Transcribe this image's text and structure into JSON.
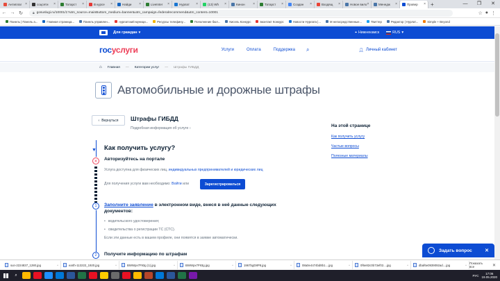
{
  "browser": {
    "tabs": [
      {
        "label": "Антиплаг",
        "color": "#e74c3c"
      },
      {
        "label": "соцсети",
        "color": "#333333"
      },
      {
        "label": "Татарст",
        "color": "#2e7d32"
      },
      {
        "label": "В курсе",
        "color": "#e53935"
      },
      {
        "label": "Найди",
        "color": "#1565c0"
      },
      {
        "label": "LiveInter",
        "color": "#2e7d32"
      },
      {
        "label": "Нурлат",
        "color": "#1976d2"
      },
      {
        "label": "(13) Wh",
        "color": "#25d366"
      },
      {
        "label": "Кинон",
        "color": "#4a76a8"
      },
      {
        "label": "Татарст",
        "color": "#2e7d32"
      },
      {
        "label": "Создан",
        "color": "#4285f4"
      },
      {
        "label": "Входящ",
        "color": "#ea4335"
      },
      {
        "label": "Новое вило",
        "color": "#4a76a8"
      },
      {
        "label": "Менедж",
        "color": "#4a76a8"
      },
      {
        "label": "Провер",
        "color": "#0d4cd3"
      }
    ],
    "active_tab_index": 14,
    "new_tab": "+",
    "window_controls": [
      "—",
      "❐",
      "✕"
    ],
    "url": "gosuslugi.ru/10001/1?utm_source=mainButtom_medium=banner&utm_campaign=federalrecommend&utm_content=10001",
    "bookmarks": [
      {
        "label": "Панель | Панель а...",
        "color": "#2e7d32"
      },
      {
        "label": "Главная страница...",
        "color": "#1565c0"
      },
      {
        "label": "Панель управлен...",
        "color": "#4a76a8"
      },
      {
        "label": "нурлатский муници...",
        "color": "#e53935"
      },
      {
        "label": "Ресурсы телефину...",
        "color": "#f4b400"
      },
      {
        "label": "Пополнение бюл...",
        "color": "#2e7d32"
      },
      {
        "label": "Кисель Конкурс",
        "color": "#4a76a8"
      },
      {
        "label": "вконтакт Конкурс",
        "color": "#e53935"
      },
      {
        "label": "Новости Нурлата |...",
        "color": "#1976d2"
      },
      {
        "label": "М непосредственные...",
        "color": "#4a76a8"
      },
      {
        "label": "Твиттер",
        "color": "#1da1f2"
      },
      {
        "label": "Редактор | Нурлат...",
        "color": "#4a76a8"
      },
      {
        "label": "Simple + Beyond",
        "color": "#f57c00"
      }
    ]
  },
  "topbar": {
    "for_citizens": "Для граждан",
    "location": "Нижнекамск",
    "language": "RUS"
  },
  "header": {
    "logo_part1": "гос",
    "logo_part2": "услуги",
    "nav": [
      "Услуги",
      "Оплата",
      "Поддержка"
    ],
    "cabinet": "Личный кабинет"
  },
  "breadcrumb": {
    "home": "Главная",
    "category": "Категории услуг",
    "current": "Штрафы ГИБДД"
  },
  "page": {
    "title": "Автомобильные и дорожные штрафы",
    "back": "Вернуться",
    "service_title": "Штрафы ГИБДД",
    "service_more": "Подробная информация об услуге",
    "how_title": "Как получить услугу?",
    "step0_title": "Авторизуйтесь на портале",
    "step0_text_prefix": "Услуга доступна для физических лиц, ",
    "step0_text_link": "индивидуальных предпринимателей и юридических лиц",
    "step0_need_prefix": "Для получения услуги вам необходимо: ",
    "step0_login": "Войти",
    "step0_or": " или",
    "register_button": "Зарегистрироваться",
    "step1_number": "1",
    "step1_link": "Заполните заявление",
    "step1_rest": " в электронном виде, внеся в неё данные следующих",
    "step1_rest2": "документов:",
    "step1_bullets": [
      "водительского удостоверения;",
      "свидетельства о регистрации ТС (СТС)."
    ],
    "step1_note": "Если эти данные есть в вашем профиле, они появятся в заявке автоматически.",
    "step2_number": "2",
    "step2_title": "Получите информацию по штрафам"
  },
  "sidebar": {
    "title": "На этой странице",
    "links": [
      "Как получить услугу",
      "Частые вопросы",
      "Полезные материалы"
    ]
  },
  "chat": {
    "label": "Задать вопрос"
  },
  "downloads": {
    "items": [
      "sun-2224837_1280.jpg",
      "earth-113222_1920.jpg",
      "BWWpx7F93g (1).jpg",
      "BWWpx7F93g.jpg",
      "1967bgD8P8.jpg",
      "08a0e4474bd8b1....jpg",
      "0f6e82c0b73ef02....jpg",
      "dbaf6e0939092ad....jpg"
    ],
    "show_all": "Показать все"
  },
  "taskbar": {
    "apps": [
      "#ffb900",
      "#e81123",
      "#1e90ff",
      "#0078d7",
      "#2b579a",
      "#217346",
      "#e81123",
      "#ffcc00",
      "#6b6b6b",
      "#e81123",
      "#ffb900",
      "#b7472a",
      "#0078d7",
      "#2b579a",
      "#217346",
      "#7719aa"
    ],
    "time": "17:06",
    "date": "19.05.2020",
    "lang": "РУС"
  }
}
